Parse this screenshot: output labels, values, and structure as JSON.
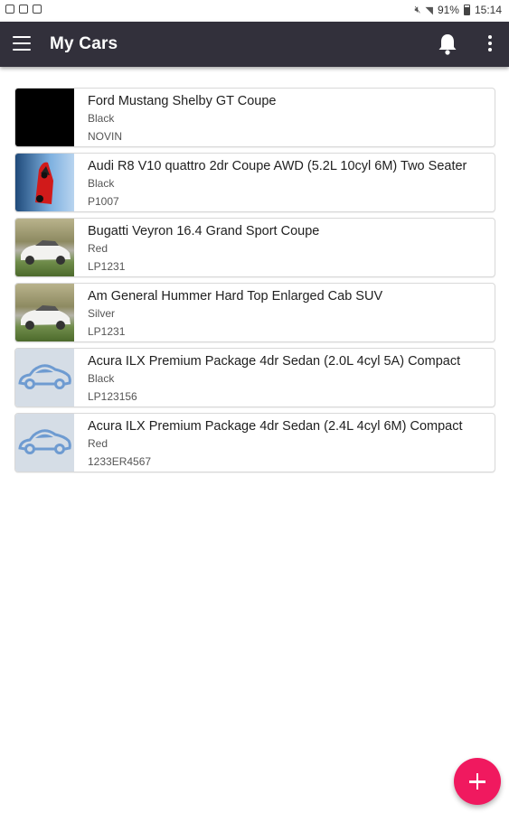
{
  "status_bar": {
    "battery": "91%",
    "time": "15:14"
  },
  "app_bar": {
    "title": "My Cars",
    "icons": [
      "menu-icon",
      "bell-icon",
      "more-vert-icon"
    ]
  },
  "cars": [
    {
      "name": "Ford Mustang Shelby GT Coupe",
      "color": "Black",
      "plate": "NOVIN",
      "thumb": "black"
    },
    {
      "name": "Audi R8 V10 quattro 2dr Coupe AWD (5.2L 10cyl 6M) Two Seater",
      "color": "Black",
      "plate": "P1007",
      "thumb": "red-car"
    },
    {
      "name": "Bugatti Veyron 16.4 Grand Sport Coupe",
      "color": "Red",
      "plate": "LP1231",
      "thumb": "photo"
    },
    {
      "name": "Am General Hummer Hard Top Enlarged Cab SUV",
      "color": "Silver",
      "plate": "LP1231",
      "thumb": "photo"
    },
    {
      "name": "Acura ILX Premium Package 4dr Sedan (2.0L 4cyl 5A) Compact",
      "color": "Black",
      "plate": "LP123156",
      "thumb": "placeholder"
    },
    {
      "name": "Acura ILX Premium Package 4dr Sedan (2.4L 4cyl 6M) Compact",
      "color": "Red",
      "plate": "1233ER4567",
      "thumb": "placeholder"
    }
  ],
  "fab": {
    "icon": "plus-icon"
  },
  "colors": {
    "app_bar": "#32303b",
    "fab": "#f0195f",
    "placeholder_car": "#6e9bd1"
  }
}
